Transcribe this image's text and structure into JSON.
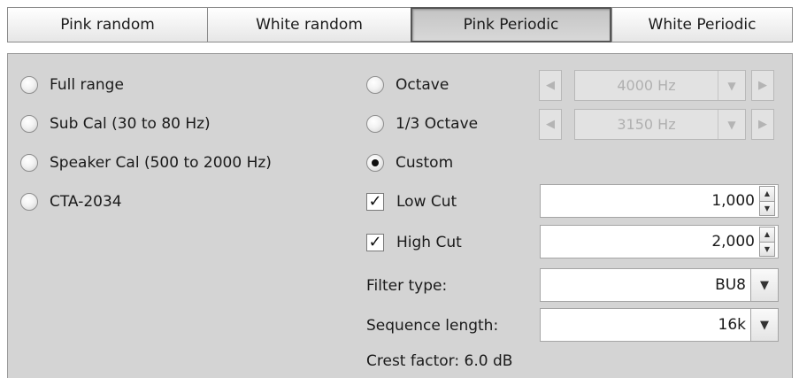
{
  "tabs": [
    {
      "label": "Pink random",
      "active": false
    },
    {
      "label": "White random",
      "active": false
    },
    {
      "label": "Pink Periodic",
      "active": true
    },
    {
      "label": "White Periodic",
      "active": false
    }
  ],
  "left_options": [
    {
      "label": "Full range",
      "selected": false
    },
    {
      "label": "Sub Cal (30 to 80 Hz)",
      "selected": false
    },
    {
      "label": "Speaker Cal (500 to 2000 Hz)",
      "selected": false
    },
    {
      "label": "CTA-2034",
      "selected": false
    }
  ],
  "right_options": {
    "octave": {
      "label": "Octave",
      "selected": false,
      "value": "4000 Hz"
    },
    "third_octave": {
      "label": "1/3 Octave",
      "selected": false,
      "value": "3150 Hz"
    },
    "custom": {
      "label": "Custom",
      "selected": true
    }
  },
  "low_cut": {
    "label": "Low Cut",
    "checked": true,
    "value": "1,000"
  },
  "high_cut": {
    "label": "High Cut",
    "checked": true,
    "value": "2,000"
  },
  "filter_type": {
    "label": "Filter type:",
    "value": "BU8"
  },
  "sequence_length": {
    "label": "Sequence length:",
    "value": "16k"
  },
  "crest_factor": "Crest factor: 6.0 dB",
  "icons": {
    "left": "triangle-left-icon",
    "right": "triangle-right-icon",
    "down": "triangle-down-icon",
    "up": "triangle-up-icon"
  }
}
